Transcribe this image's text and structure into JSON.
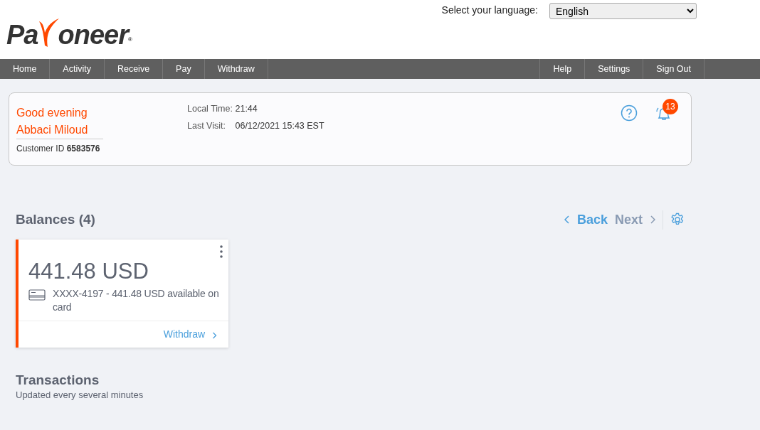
{
  "logo": {
    "before": "Pa",
    "after": "oneer",
    "mark": "®"
  },
  "language": {
    "label": "Select your language:",
    "value": "English"
  },
  "nav_left": [
    "Home",
    "Activity",
    "Receive",
    "Pay",
    "Withdraw"
  ],
  "nav_right": [
    "Help",
    "Settings",
    "Sign Out"
  ],
  "welcome": {
    "greeting": "Good evening",
    "name": "Abbaci Miloud",
    "customer_id": "Customer ID **6583576**",
    "rows": [
      {
        "label": "Local Time:",
        "value": "21:44"
      },
      {
        "label": "Last Visit:",
        "value": "06/12/2021 15:43 EST"
      }
    ],
    "notifications": "13"
  },
  "balances": {
    "title": "Balances (4)",
    "back": {
      "label": "Back",
      "disabled": false
    },
    "next": {
      "label": "Next",
      "disabled": true
    },
    "cards": [
      {
        "amount": "441.48 USD",
        "detail": "XXXX-4197 - 441.48 USD available on card",
        "action": "Withdraw",
        "color": "#ff4800"
      }
    ]
  },
  "transactions": {
    "title": "Transactions",
    "subtitle": "Updated every several minutes"
  }
}
